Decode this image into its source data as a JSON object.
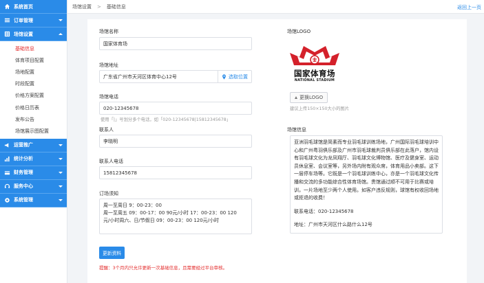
{
  "sidebar": {
    "sections": [
      {
        "label": "系统首页",
        "icon": "home-icon"
      },
      {
        "label": "订单管理",
        "icon": "order-icon"
      },
      {
        "label": "场馆设置",
        "icon": "venue-icon"
      },
      {
        "label": "运营推广",
        "icon": "promotion-icon"
      },
      {
        "label": "统计分析",
        "icon": "chart-icon"
      },
      {
        "label": "财务管理",
        "icon": "finance-icon"
      },
      {
        "label": "服务中心",
        "icon": "service-icon"
      },
      {
        "label": "系统管理",
        "icon": "system-icon"
      }
    ],
    "venue_items": [
      "基础信息",
      "体育项目配置",
      "场地配置",
      "时段配置",
      "价格方案配置",
      "价格日历表",
      "发布公告",
      "场馆展示图配置"
    ]
  },
  "topbar": {
    "breadcrumb": [
      "场馆设置",
      "基础信息"
    ],
    "separator": ">",
    "back": "返回上一页"
  },
  "form": {
    "name_label": "场馆名称",
    "name_value": "国家体育场",
    "address_label": "场馆地址",
    "address_value": "广东省广州市天河区体育中心12号",
    "locate_label": "选取位置",
    "phone_label": "场馆电话",
    "phone_value": "020-12345678",
    "phone_hint": "使用「|」号划分多个电话，如「020-12345678|15812345678」",
    "contact_label": "联系人",
    "contact_value": "李晓明",
    "contact_phone_label": "联系人电话",
    "contact_phone_value": "15812345678",
    "notice_label": "订场须知",
    "notice_lines": [
      "周一至周日  9：00-23：00",
      "周一至周五  09：00-17：00  90元/小时  17：00-23：00  120",
      "元/小时周六、日/节假日 09：00-23：00 120元/小时"
    ],
    "logo_label": "场馆LOGO",
    "logo_text_cn": "国家体育场",
    "logo_text_en": "NATIONAL STADIUM",
    "change_logo": "更换LOGO",
    "logo_hint": "建议上传150×150大小的图片",
    "info_label": "场馆信息",
    "info_lines": [
      "亚洲羽毛球馆是简素而专业羽毛球训练场地，广州国际羽毛球培训中",
      "心和广州粤羽俱乐部及广州市羽毛球裁判员俱乐部在此落户，馆内设",
      "有羽毛球文化为龙凤翔厅、羽毛球文化博物馆、医疗及健身室、运动",
      "员休息室、会议室等，另外场内附有观众席，体育用品小卖部。这下",
      "一层停车场等。它既是一个羽毛球训练中心，亦是一个羽毛球文化传",
      "播和交流的多功能综合性体育场馆。贵馆通过顺不可用于比赛或培",
      "训，一片场地至少两个人使用。如客户违反规则，球馆有权收回场地",
      "或拒退的收费！"
    ],
    "info_contact": "联系电话：020-12345678",
    "info_address": "地址：广州市天河区什么路什么12号",
    "submit": "更新资料",
    "warning": "提醒：3个月内只允许更新一次基础信息，且需要经过平台审核。"
  },
  "colors": {
    "primary": "#2a8be8",
    "warning": "#e32b2b",
    "logo_red": "#d4212b"
  }
}
